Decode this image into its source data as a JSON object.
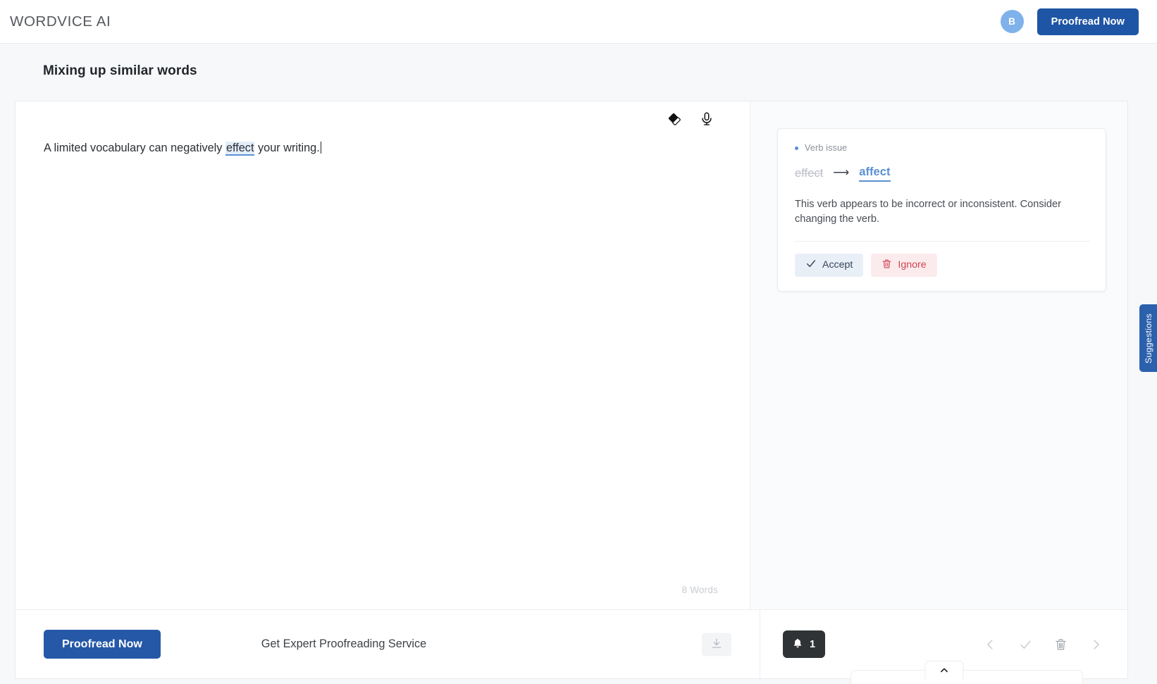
{
  "topbar": {
    "logo": "WORDVICE AI",
    "avatar_initial": "B",
    "proofread_label": "Proofread Now"
  },
  "document": {
    "title": "Mixing up similar words",
    "text_before": "A limited vocabulary can negatively ",
    "highlighted_word": "effect",
    "text_after": " your writing.",
    "word_count": "8 Words"
  },
  "editor_tools": {
    "eraser": "eraser-icon",
    "microphone": "microphone-icon"
  },
  "suggestion": {
    "kind": "Verb issue",
    "original": "effect",
    "arrow": "⟶",
    "replacement": "affect",
    "description": "This verb appears to be incorrect or inconsistent. Consider changing the verb.",
    "accept_label": "Accept",
    "ignore_label": "Ignore"
  },
  "side_tab": {
    "label": "Suggestions"
  },
  "bottombar": {
    "proofread_label": "Proofread Now",
    "expert_label": "Get Expert Proofreading Service",
    "download_icon": "download-icon",
    "notification_count": "1",
    "nav": {
      "prev": "chevron-left-icon",
      "accept": "check-icon",
      "delete": "trash-icon",
      "next": "chevron-right-icon",
      "collapse": "chevron-up-icon"
    }
  },
  "colors": {
    "brand_blue": "#1f55a5",
    "accent_blue": "#5b90d1",
    "avatar_blue": "#7fb2eb",
    "ignore_red": "#cf4350",
    "page_bg": "#f7f8fa",
    "panel_bg": "#fafbfc"
  }
}
